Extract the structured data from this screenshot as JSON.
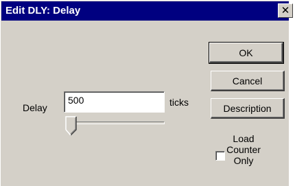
{
  "window": {
    "title": "Edit DLY:  Delay",
    "close_glyph": "✕"
  },
  "buttons": {
    "ok": "OK",
    "cancel": "Cancel",
    "description": "Description"
  },
  "delay": {
    "label": "Delay",
    "value": "500",
    "unit": "ticks"
  },
  "slider": {
    "position_fraction": 0.0
  },
  "load_counter_only": {
    "lines": [
      "Load",
      "Counter",
      "Only"
    ],
    "checked": false
  },
  "colors": {
    "titlebar": "#000080",
    "face": "#d4d0c8"
  }
}
